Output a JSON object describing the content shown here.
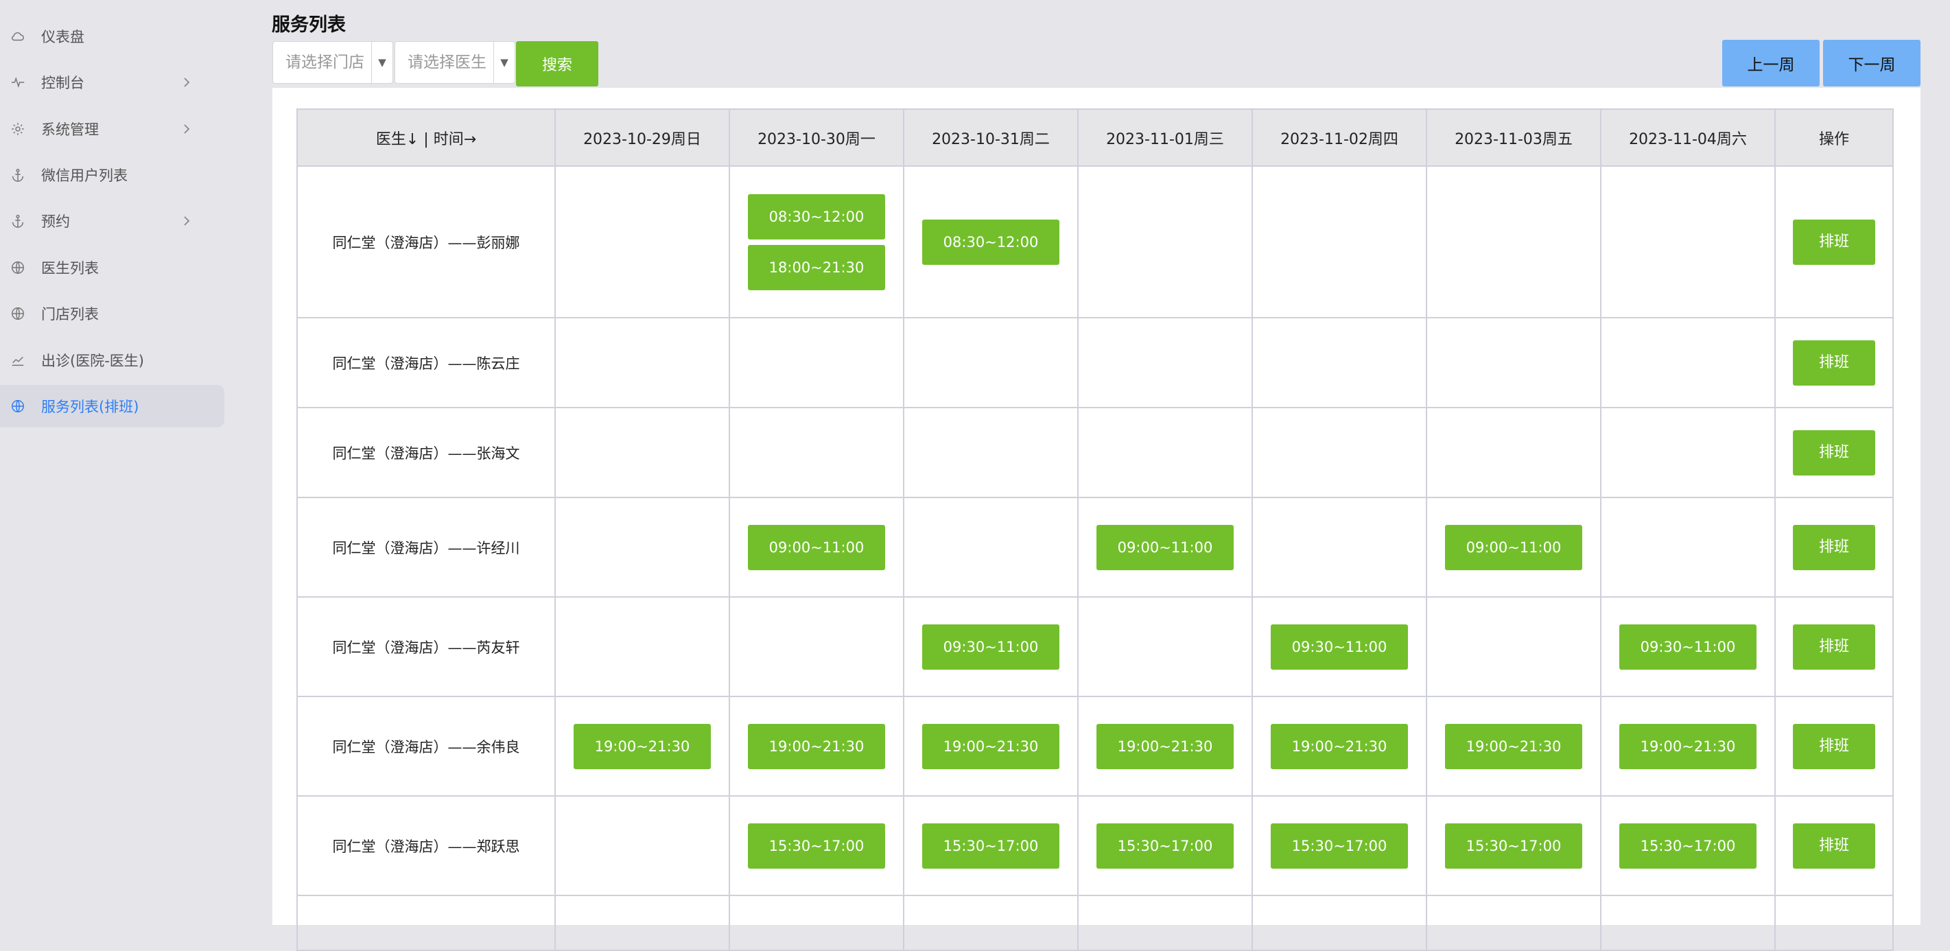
{
  "sidebar": {
    "items": [
      {
        "label": "仪表盘",
        "icon": "cloud-icon",
        "has_submenu": false,
        "active": false
      },
      {
        "label": "控制台",
        "icon": "pulse-icon",
        "has_submenu": true,
        "active": false
      },
      {
        "label": "系统管理",
        "icon": "gear-icon",
        "has_submenu": true,
        "active": false
      },
      {
        "label": "微信用户列表",
        "icon": "anchor-icon",
        "has_submenu": false,
        "active": false
      },
      {
        "label": "预约",
        "icon": "anchor-icon",
        "has_submenu": true,
        "active": false
      },
      {
        "label": "医生列表",
        "icon": "globe-icon",
        "has_submenu": false,
        "active": false
      },
      {
        "label": "门店列表",
        "icon": "globe-icon",
        "has_submenu": false,
        "active": false
      },
      {
        "label": "出诊(医院-医生)",
        "icon": "chart-line-icon",
        "has_submenu": false,
        "active": false
      },
      {
        "label": "服务列表(排班)",
        "icon": "globe-icon",
        "has_submenu": false,
        "active": true
      }
    ]
  },
  "header": {
    "title": "服务列表",
    "store_select": {
      "placeholder": "请选择门店",
      "value": ""
    },
    "doctor_select": {
      "placeholder": "请选择医生",
      "value": ""
    },
    "search_label": "搜索",
    "prev_week_label": "上一周",
    "next_week_label": "下一周"
  },
  "table": {
    "corner_header": "医生↓ | 时间→",
    "dates": [
      "2023-10-29周日",
      "2023-10-30周一",
      "2023-10-31周二",
      "2023-11-01周三",
      "2023-11-02周四",
      "2023-11-03周五",
      "2023-11-04周六"
    ],
    "action_header": "操作",
    "action_label": "排班",
    "rows": [
      {
        "doctor": "同仁堂（澄海店）——彭丽娜",
        "slots": [
          [],
          [
            "08:30~12:00",
            "18:00~21:30"
          ],
          [
            "08:30~12:00"
          ],
          [],
          [],
          [],
          []
        ]
      },
      {
        "doctor": "同仁堂（澄海店）——陈云庄",
        "slots": [
          [],
          [],
          [],
          [],
          [],
          [],
          []
        ]
      },
      {
        "doctor": "同仁堂（澄海店）——张海文",
        "slots": [
          [],
          [],
          [],
          [],
          [],
          [],
          []
        ]
      },
      {
        "doctor": "同仁堂（澄海店）——许经川",
        "slots": [
          [],
          [
            "09:00~11:00"
          ],
          [],
          [
            "09:00~11:00"
          ],
          [],
          [
            "09:00~11:00"
          ],
          []
        ]
      },
      {
        "doctor": "同仁堂（澄海店）——芮友轩",
        "slots": [
          [],
          [],
          [
            "09:30~11:00"
          ],
          [],
          [
            "09:30~11:00"
          ],
          [],
          [
            "09:30~11:00"
          ]
        ]
      },
      {
        "doctor": "同仁堂（澄海店）——余伟良",
        "slots": [
          [
            "19:00~21:30"
          ],
          [
            "19:00~21:30"
          ],
          [
            "19:00~21:30"
          ],
          [
            "19:00~21:30"
          ],
          [
            "19:00~21:30"
          ],
          [
            "19:00~21:30"
          ],
          [
            "19:00~21:30"
          ]
        ]
      },
      {
        "doctor": "同仁堂（澄海店）——郑跃思",
        "slots": [
          [],
          [
            "15:30~17:00"
          ],
          [
            "15:30~17:00"
          ],
          [
            "15:30~17:00"
          ],
          [
            "15:30~17:00"
          ],
          [
            "15:30~17:00"
          ],
          [
            "15:30~17:00"
          ]
        ]
      }
    ]
  },
  "colors": {
    "accent_green": "#72bf2b",
    "accent_blue": "#72b1f6",
    "active_text": "#2f7df6",
    "background": "#e5e5ea"
  }
}
